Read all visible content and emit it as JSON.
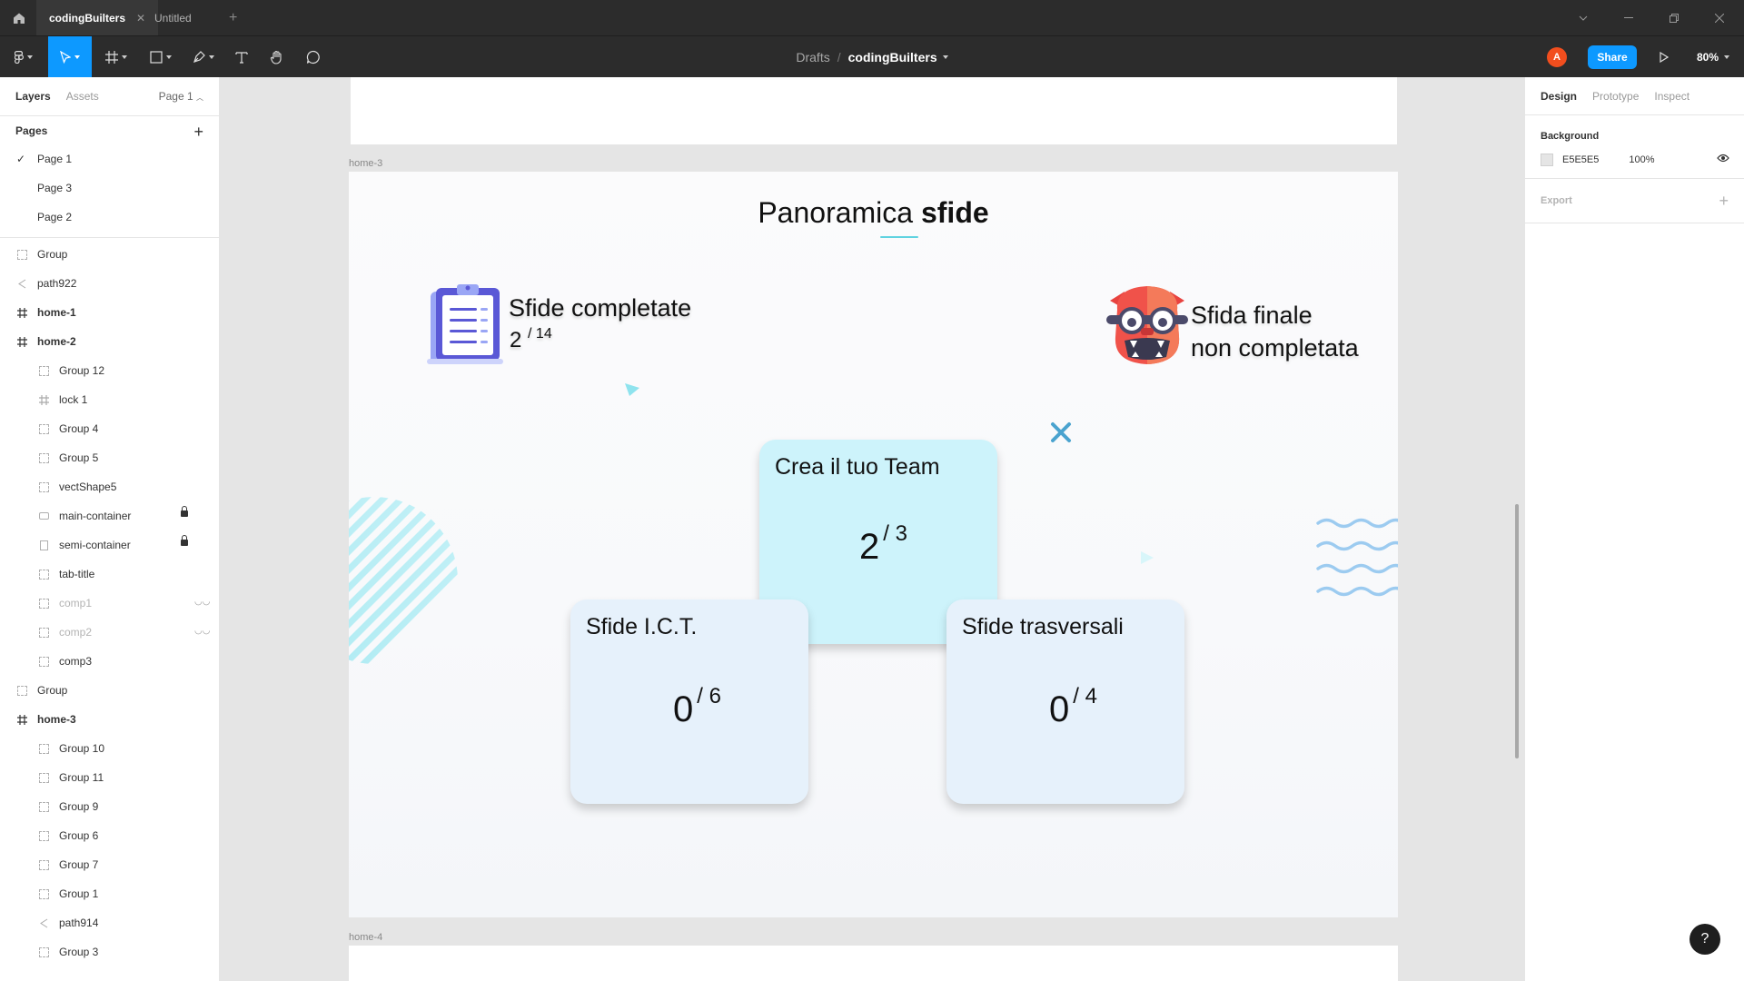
{
  "titlebar": {
    "tabs": [
      {
        "label": "codingBuilters",
        "close": "✕"
      },
      {
        "label": "Untitled"
      }
    ],
    "new_tab": "+"
  },
  "toolbar": {
    "breadcrumb": {
      "parent": "Drafts",
      "separator": "/",
      "file": "codingBuilters"
    },
    "avatar_initial": "A",
    "share_label": "Share",
    "zoom": "80%"
  },
  "left_panel": {
    "tabs": {
      "layers": "Layers",
      "assets": "Assets",
      "page": "Page 1"
    },
    "pages_heading": "Pages",
    "pages": [
      {
        "label": "Page 1",
        "current": true
      },
      {
        "label": "Page 3"
      },
      {
        "label": "Page 2"
      }
    ],
    "layers": [
      {
        "label": "Group",
        "icon": "group-icon",
        "indent": 0
      },
      {
        "label": "path922",
        "icon": "path-icon",
        "indent": 0
      },
      {
        "label": "home-1",
        "icon": "frame-icon",
        "indent": 0,
        "frame": true
      },
      {
        "label": "home-2",
        "icon": "frame-icon",
        "indent": 0,
        "frame": true
      },
      {
        "label": "Group 12",
        "icon": "group-icon",
        "indent": 1
      },
      {
        "label": "lock 1",
        "icon": "frame-icon",
        "indent": 1
      },
      {
        "label": "Group 4",
        "icon": "group-icon",
        "indent": 1
      },
      {
        "label": "Group 5",
        "icon": "group-icon",
        "indent": 1
      },
      {
        "label": "vectShape5",
        "icon": "group-icon",
        "indent": 1
      },
      {
        "label": "main-container",
        "icon": "rectangle-icon",
        "indent": 1,
        "locked": true
      },
      {
        "label": "semi-container",
        "icon": "rectangle-icon",
        "indent": 1,
        "locked": true
      },
      {
        "label": "tab-title",
        "icon": "group-icon",
        "indent": 1
      },
      {
        "label": "comp1",
        "icon": "group-icon",
        "indent": 1,
        "hidden": true
      },
      {
        "label": "comp2",
        "icon": "group-icon",
        "indent": 1,
        "hidden": true
      },
      {
        "label": "comp3",
        "icon": "group-icon",
        "indent": 1
      },
      {
        "label": "Group",
        "icon": "group-icon",
        "indent": 0
      },
      {
        "label": "home-3",
        "icon": "frame-icon",
        "indent": 0,
        "frame": true
      },
      {
        "label": "Group 10",
        "icon": "group-icon",
        "indent": 1
      },
      {
        "label": "Group 11",
        "icon": "group-icon",
        "indent": 1
      },
      {
        "label": "Group 9",
        "icon": "group-icon",
        "indent": 1
      },
      {
        "label": "Group 6",
        "icon": "group-icon",
        "indent": 1
      },
      {
        "label": "Group 7",
        "icon": "group-icon",
        "indent": 1
      },
      {
        "label": "Group 1",
        "icon": "group-icon",
        "indent": 1
      },
      {
        "label": "path914",
        "icon": "path-icon",
        "indent": 1
      },
      {
        "label": "Group 3",
        "icon": "group-icon",
        "indent": 1
      }
    ]
  },
  "canvas": {
    "frame_labels": {
      "home3": "home-3",
      "home4": "home-4"
    },
    "home3": {
      "title_light": "Panoramica",
      "title_bold": "sfide",
      "completed_label": "Sfide completate",
      "completed_value": "2",
      "completed_total": "/ 14",
      "final_line1": "Sfida finale",
      "final_line2": "non completata",
      "cards": {
        "team": {
          "title": "Crea il tuo Team",
          "value": "2",
          "total": "/ 3"
        },
        "ict": {
          "title": "Sfide I.C.T.",
          "value": "0",
          "total": "/ 6"
        },
        "trasversali": {
          "title": "Sfide trasversali",
          "value": "0",
          "total": "/ 4"
        }
      }
    }
  },
  "right_panel": {
    "tabs": {
      "design": "Design",
      "prototype": "Prototype",
      "inspect": "Inspect"
    },
    "background": {
      "heading": "Background",
      "hex": "E5E5E5",
      "opacity": "100%"
    },
    "export": {
      "heading": "Export",
      "add": "+"
    }
  },
  "help": "?",
  "colors": {
    "accent": "#0d99ff",
    "toolbar": "#2c2c2c",
    "canvas": "#e5e5e5",
    "card_team": "#cdf3fb",
    "card": "#e6f1fb"
  }
}
